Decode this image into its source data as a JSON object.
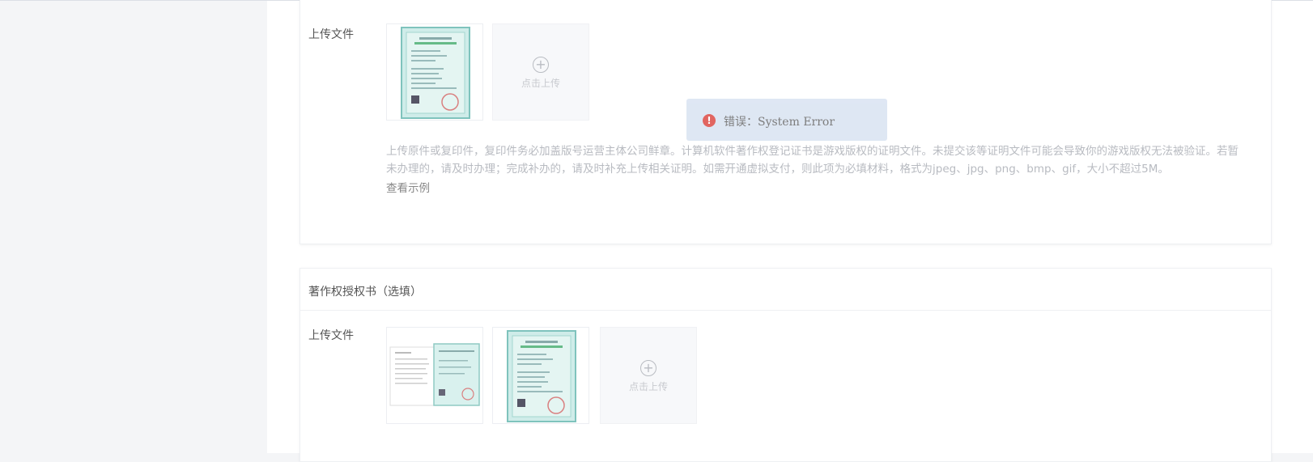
{
  "section1": {
    "field_label": "上传文件",
    "upload_label": "点击上传",
    "hint": "上传原件或复印件，复印件务必加盖版号运营主体公司鲜章。计算机软件著作权登记证书是游戏版权的证明文件。未提交该等证明文件可能会导致你的游戏版权无法被验证。若暂未办理的，请及时办理；完成补办的，请及时补充上传相关证明。如需开通虚拟支付，则此项为必填材料，格式为jpeg、jpg、png、bmp、gif，大小不超过5M。",
    "example_link": "查看示例"
  },
  "section2": {
    "title": "著作权授权书（选填）",
    "field_label": "上传文件",
    "upload_label": "点击上传"
  },
  "toast": {
    "icon": "error-icon",
    "message": "错误：System Error",
    "color": "#e05d58"
  }
}
